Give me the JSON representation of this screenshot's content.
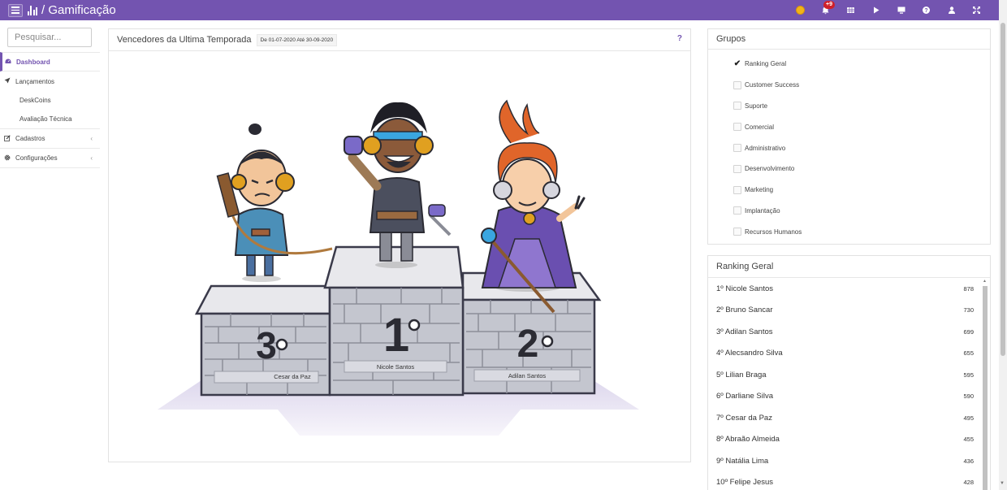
{
  "app": {
    "title": "Gamificação",
    "notification_count": "+9"
  },
  "topbar": {
    "icons": [
      "coin-icon",
      "bell-icon",
      "grid-icon",
      "play-icon",
      "monitor-icon",
      "help-icon",
      "user-icon",
      "expand-icon"
    ]
  },
  "sidebar": {
    "search_placeholder": "Pesquisar...",
    "items": [
      {
        "label": "Dashboard",
        "icon": "dashboard-icon",
        "active": true
      },
      {
        "label": "Lançamentos",
        "icon": "send-icon"
      },
      {
        "label": "DeskCoins",
        "sub": true
      },
      {
        "label": "Avaliação Técnica",
        "sub": true
      },
      {
        "label": "Cadastros",
        "icon": "edit-icon",
        "chevron": "‹"
      },
      {
        "label": "Configurações",
        "icon": "gear-icon",
        "chevron": "‹"
      }
    ]
  },
  "winners": {
    "title": "Vencedores da Ultima Temporada",
    "date_range": "De 01-07-2020 Até 30-09-2020",
    "help": "?",
    "podium": {
      "first": {
        "place": "1º",
        "name": "Nicole Santos"
      },
      "second": {
        "place": "2º",
        "name": "Adilan Santos"
      },
      "third": {
        "place": "3º",
        "name": "Cesar da Paz"
      }
    }
  },
  "groups": {
    "title": "Grupos",
    "items": [
      {
        "label": "Ranking Geral",
        "checked": true
      },
      {
        "label": "Customer Success",
        "checked": false
      },
      {
        "label": "Suporte",
        "checked": false
      },
      {
        "label": "Comercial",
        "checked": false
      },
      {
        "label": "Administrativo",
        "checked": false
      },
      {
        "label": "Desenvolvimento",
        "checked": false
      },
      {
        "label": "Marketing",
        "checked": false
      },
      {
        "label": "Implantação",
        "checked": false
      },
      {
        "label": "Recursos Humanos",
        "checked": false
      }
    ]
  },
  "ranking": {
    "title": "Ranking Geral",
    "items": [
      {
        "label": "1º Nicole Santos",
        "score": "878"
      },
      {
        "label": "2º Bruno Sancar",
        "score": "730"
      },
      {
        "label": "3º Adilan Santos",
        "score": "699"
      },
      {
        "label": "4º Alecsandro Silva",
        "score": "655"
      },
      {
        "label": "5º Lilian Braga",
        "score": "595"
      },
      {
        "label": "6º Darliane Silva",
        "score": "590"
      },
      {
        "label": "7º Cesar da Paz",
        "score": "495"
      },
      {
        "label": "8º Abraão Almeida",
        "score": "455"
      },
      {
        "label": "9º Natália Lima",
        "score": "436"
      },
      {
        "label": "10º Felipe Jesus",
        "score": "428"
      }
    ]
  },
  "colors": {
    "brand": "#7354b0",
    "badge": "#d0202a"
  }
}
